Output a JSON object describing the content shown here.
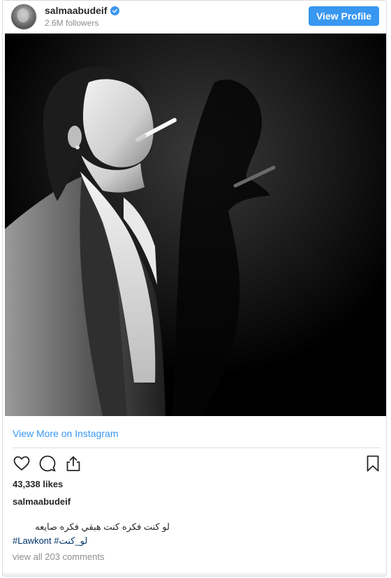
{
  "header": {
    "username": "salmaabudeif",
    "followers": "2.6M followers",
    "view_profile_label": "View Profile",
    "verified_icon": "verified-badge-icon"
  },
  "post": {
    "image_icon": "post-photo",
    "view_more_label": "View More on Instagram",
    "likes": "43,338 likes",
    "caption_user": "salmaabudeif",
    "caption_text": "لو كنت فكره كنت هبقي فكره صايعه",
    "hashtag_1": "#لو_كنت",
    "hashtag_2": "#Lawkont",
    "comments_link": "view all 203 comments"
  },
  "icons": {
    "like": "heart-icon",
    "comment": "comment-icon",
    "share": "share-icon",
    "save": "bookmark-icon"
  },
  "colors": {
    "accent": "#3897f0",
    "text": "#262626",
    "muted": "#8e8e8e",
    "border": "#dbdbdb",
    "hashtag": "#00376b"
  }
}
